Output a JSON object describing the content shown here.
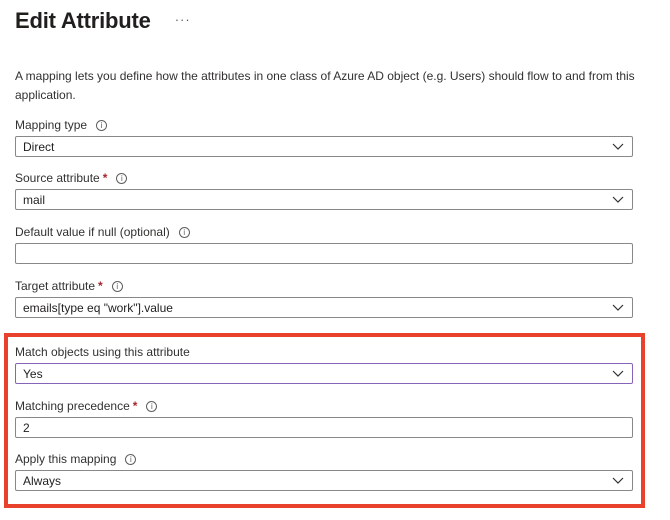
{
  "header": {
    "title": "Edit Attribute",
    "more": "···"
  },
  "description": "A mapping lets you define how the attributes in one class of Azure AD object (e.g. Users) should flow to and from this application.",
  "fields": {
    "mapping_type": {
      "label": "Mapping type",
      "value": "Direct"
    },
    "source_attribute": {
      "label": "Source attribute",
      "required": "*",
      "value": "mail"
    },
    "default_value": {
      "label": "Default value if null (optional)",
      "value": ""
    },
    "target_attribute": {
      "label": "Target attribute",
      "required": "*",
      "value": "emails[type eq \"work\"].value"
    },
    "match_objects": {
      "label": "Match objects using this attribute",
      "value": "Yes"
    },
    "matching_precedence": {
      "label": "Matching precedence",
      "required": "*",
      "value": "2"
    },
    "apply_mapping": {
      "label": "Apply this mapping",
      "value": "Always"
    }
  },
  "icons": {
    "info": "info-icon",
    "dropdown": "chevron-down-icon",
    "more": "more-icon"
  },
  "colors": {
    "highlight": "#e8412c",
    "required": "#a4262c",
    "focus": "#8764b8"
  }
}
